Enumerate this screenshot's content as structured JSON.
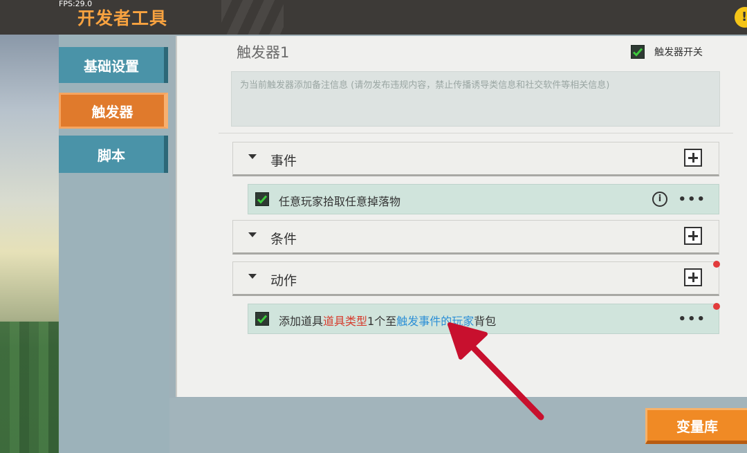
{
  "header": {
    "fps": "FPS:29.0",
    "title": "开发者工具",
    "help_glyph": "!"
  },
  "sidebar": {
    "items": [
      {
        "label": "基础设置",
        "active": false
      },
      {
        "label": "触发器",
        "active": true
      },
      {
        "label": "脚本",
        "active": false
      }
    ]
  },
  "trigger": {
    "title": "触发器1",
    "switch_label": "触发器开关",
    "switch_checked": true,
    "note_placeholder": "为当前触发器添加备注信息 (请勿发布违规内容，禁止传播诱导类信息和社交软件等相关信息)"
  },
  "sections": {
    "event": {
      "label": "事件"
    },
    "condition": {
      "label": "条件"
    },
    "action": {
      "label": "动作"
    }
  },
  "event_item": {
    "text": "任意玩家拾取任意掉落物",
    "checked": true
  },
  "action_item": {
    "checked": true,
    "parts": [
      "添加道具",
      "道具类型",
      "1个至",
      "触发事件的",
      "玩家",
      "背包"
    ]
  },
  "more_glyph": "•••",
  "info_glyph": "i",
  "footer": {
    "variable_button": "变量库"
  },
  "colors": {
    "accent_orange": "#f08a25",
    "param_red": "#d63a2c",
    "param_blue": "#2c8fd6",
    "annotation_arrow": "#c8102e"
  }
}
